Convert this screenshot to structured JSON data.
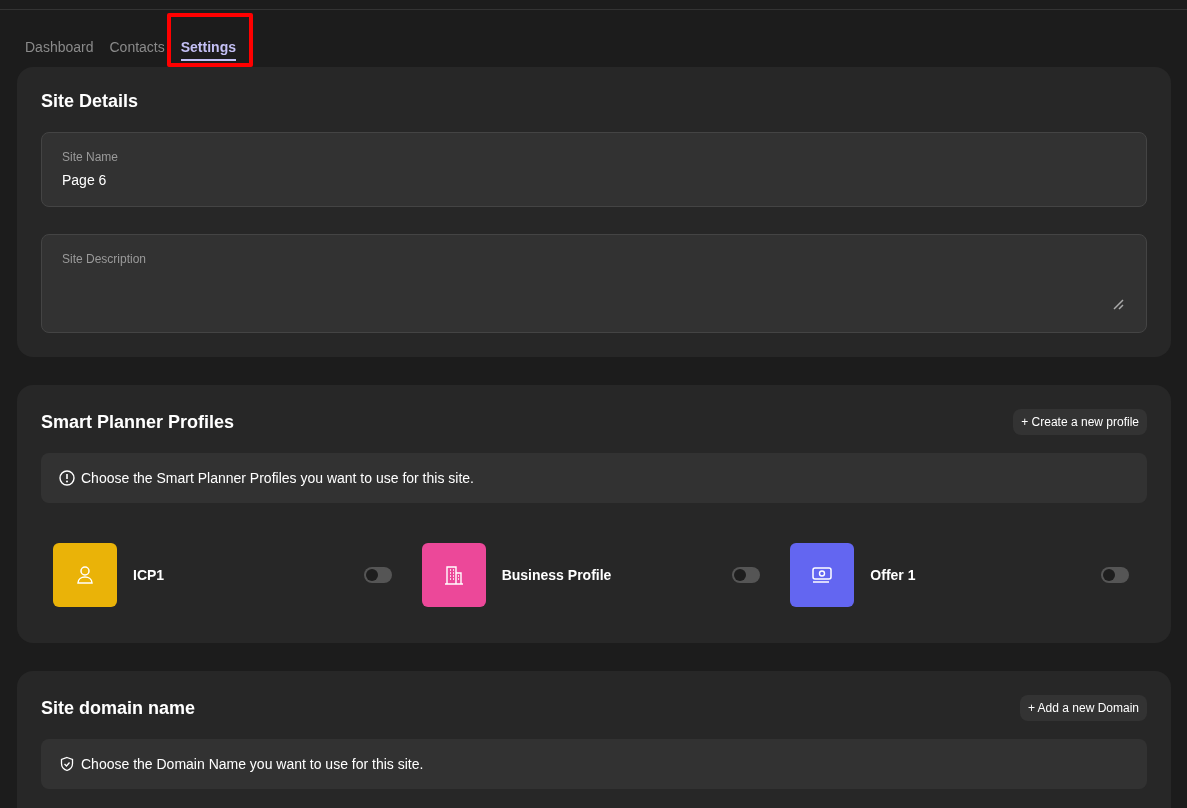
{
  "tabs": [
    {
      "label": "Dashboard",
      "selected": false
    },
    {
      "label": "Contacts",
      "selected": false
    },
    {
      "label": "Settings",
      "selected": true,
      "highlighted": true
    }
  ],
  "site_details": {
    "title": "Site Details",
    "name_field": {
      "label": "Site Name",
      "value": "Page 6"
    },
    "description_field": {
      "label": "Site Description"
    }
  },
  "profiles": {
    "title": "Smart Planner Profiles",
    "button": "+ Create a new profile",
    "notice": "Choose the Smart Planner Profiles you want to use for this site.",
    "items": [
      {
        "name": "ICP1",
        "kind": "person",
        "color": "#eab308",
        "on": false
      },
      {
        "name": "Business Profile",
        "kind": "building",
        "color": "#ec4899",
        "on": false
      },
      {
        "name": "Offer 1",
        "kind": "money",
        "color": "#6366f1",
        "on": false
      }
    ]
  },
  "domain": {
    "title": "Site domain name",
    "button": "+ Add a new Domain",
    "notice": "Choose the Domain Name you want to use for this site."
  }
}
